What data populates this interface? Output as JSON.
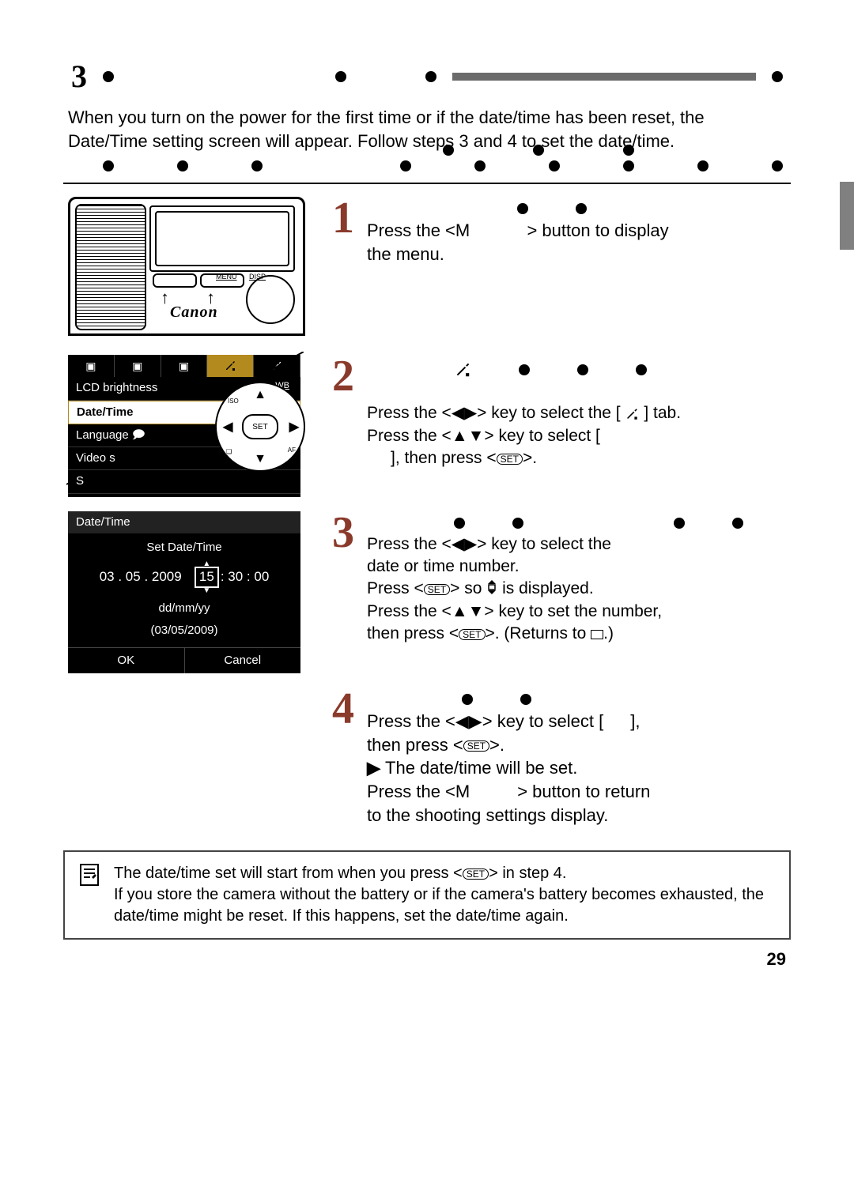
{
  "header": {
    "title_number": "3"
  },
  "intro": {
    "text": "When you turn on the power for the first time or if the date/time has been reset, the Date/Time setting screen will appear. Follow steps 3 and 4 to set the date/time."
  },
  "menu_illustration": {
    "items": [
      "LCD brightness",
      "Date/Time",
      "Language",
      "Video s",
      "S"
    ],
    "labels": {
      "menu": "MENU",
      "disp": "DISP",
      "logo": "Canon",
      "wb": "WB",
      "set": "SET",
      "af": "AF"
    }
  },
  "datetime_illustration": {
    "title": "Date/Time",
    "subtitle": "Set Date/Time",
    "date": {
      "d": "03",
      "m": "05",
      "y": "2009"
    },
    "time": {
      "h": "15",
      "min": "30",
      "s": "00"
    },
    "format_label": "dd/mm/yy",
    "paren": "(03/05/2009)",
    "ok": "OK",
    "cancel": "Cancel"
  },
  "steps": {
    "s1": {
      "num": "1",
      "l1a": "Press the <M",
      "l1b": "> button to display",
      "l2": "the menu."
    },
    "s2": {
      "num": "2",
      "l1a": "Press the <",
      "l1b": "> key to select the [",
      "l1c": "] tab.",
      "l2a": "Press the <",
      "l2b": "> key to select [",
      "l3a": "], then press <",
      "l3b": ">."
    },
    "s3": {
      "num": "3",
      "l1a": "Press the <",
      "l1b": "> key to select the",
      "l2": "date or time number.",
      "l3a": "Press <",
      "l3b": "> so ",
      "l3c": " is displayed.",
      "l4a": "Press the <",
      "l4b": "> key to set the number,",
      "l5a": "then press <",
      "l5b": ">. (Returns to ",
      "l5c": ".)"
    },
    "s4": {
      "num": "4",
      "l1a": "Press the <",
      "l1b": "> key to select [",
      "l1c": "],",
      "l2a": "then press <",
      "l2b": ">.",
      "l3": "The date/time will be set.",
      "l4a": "Press the <M",
      "l4b": "> button to return",
      "l5": "to the shooting settings display."
    }
  },
  "note": {
    "l1a": "The date/time set will start from when you press <",
    "l1b": "> in step 4.",
    "l2": "If you store the camera without the battery or if the camera's battery becomes exhausted, the date/time might be reset. If this happens, set the date/time again."
  },
  "page_number": "29"
}
